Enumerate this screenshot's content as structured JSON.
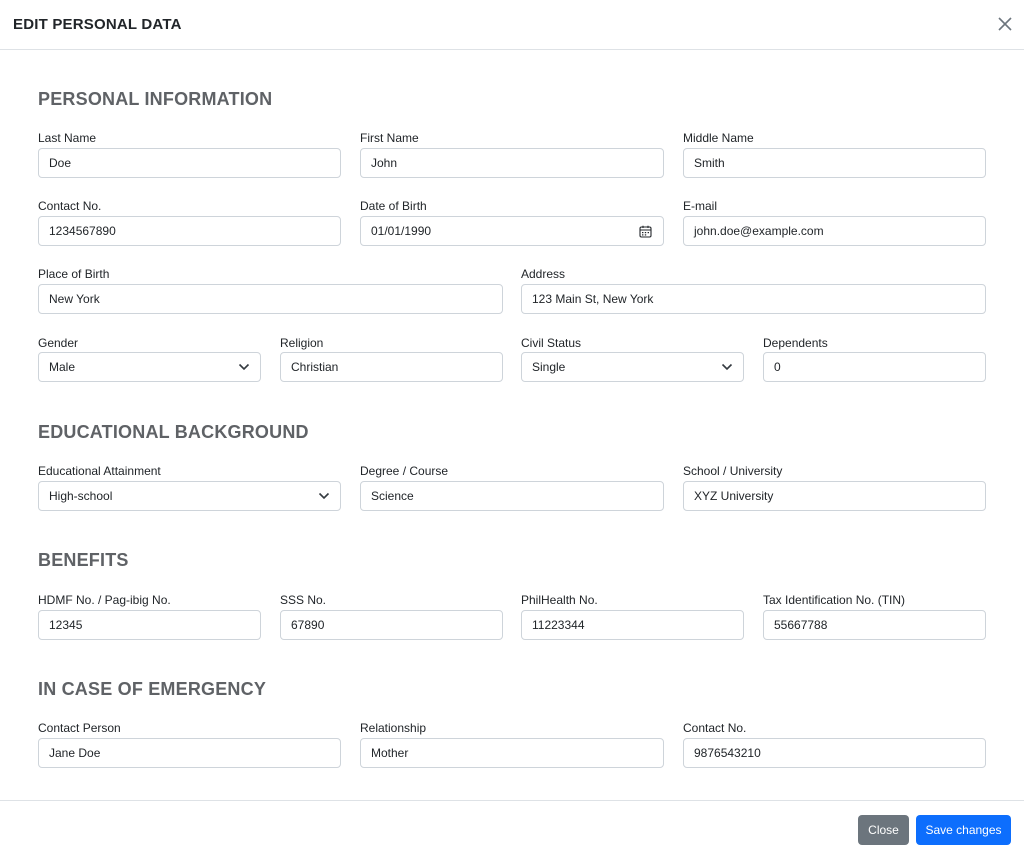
{
  "modal": {
    "title": "EDIT PERSONAL DATA",
    "close_icon": "close-icon"
  },
  "sections": {
    "personal": "PERSONAL INFORMATION",
    "education": "EDUCATIONAL BACKGROUND",
    "benefits": "BENEFITS",
    "emergency": "IN CASE OF EMERGENCY"
  },
  "personal": {
    "last_name": {
      "label": "Last Name",
      "value": "Doe"
    },
    "first_name": {
      "label": "First Name",
      "value": "John"
    },
    "middle_name": {
      "label": "Middle Name",
      "value": "Smith"
    },
    "contact_no": {
      "label": "Contact No.",
      "value": "1234567890"
    },
    "dob": {
      "label": "Date of Birth",
      "value": "01/01/1990",
      "icon": "calendar-icon"
    },
    "email": {
      "label": "E-mail",
      "value": "john.doe@example.com"
    },
    "place_of_birth": {
      "label": "Place of Birth",
      "value": "New York"
    },
    "address": {
      "label": "Address",
      "value": "123 Main St, New York"
    },
    "gender": {
      "label": "Gender",
      "value": "Male",
      "icon": "chevron-down-icon"
    },
    "religion": {
      "label": "Religion",
      "value": "Christian"
    },
    "civil_status": {
      "label": "Civil Status",
      "value": "Single",
      "icon": "chevron-down-icon"
    },
    "dependents": {
      "label": "Dependents",
      "value": "0"
    }
  },
  "education": {
    "attainment": {
      "label": "Educational Attainment",
      "value": "High-school",
      "icon": "chevron-down-icon"
    },
    "degree": {
      "label": "Degree / Course",
      "value": "Science"
    },
    "school": {
      "label": "School / University",
      "value": "XYZ University"
    }
  },
  "benefits": {
    "hdmf": {
      "label": "HDMF No. / Pag-ibig No.",
      "value": "12345"
    },
    "sss": {
      "label": "SSS No.",
      "value": "67890"
    },
    "philhealth": {
      "label": "PhilHealth No.",
      "value": "11223344"
    },
    "tin": {
      "label": "Tax Identification No. (TIN)",
      "value": "55667788"
    }
  },
  "emergency": {
    "contact_person": {
      "label": "Contact Person",
      "value": "Jane Doe"
    },
    "relationship": {
      "label": "Relationship",
      "value": "Mother"
    },
    "contact_no": {
      "label": "Contact No.",
      "value": "9876543210"
    }
  },
  "footer": {
    "close_label": "Close",
    "save_label": "Save changes"
  },
  "colors": {
    "primary": "#0d6efd",
    "secondary": "#6c757d",
    "section_title": "#5f6266",
    "border": "#ced4da"
  }
}
